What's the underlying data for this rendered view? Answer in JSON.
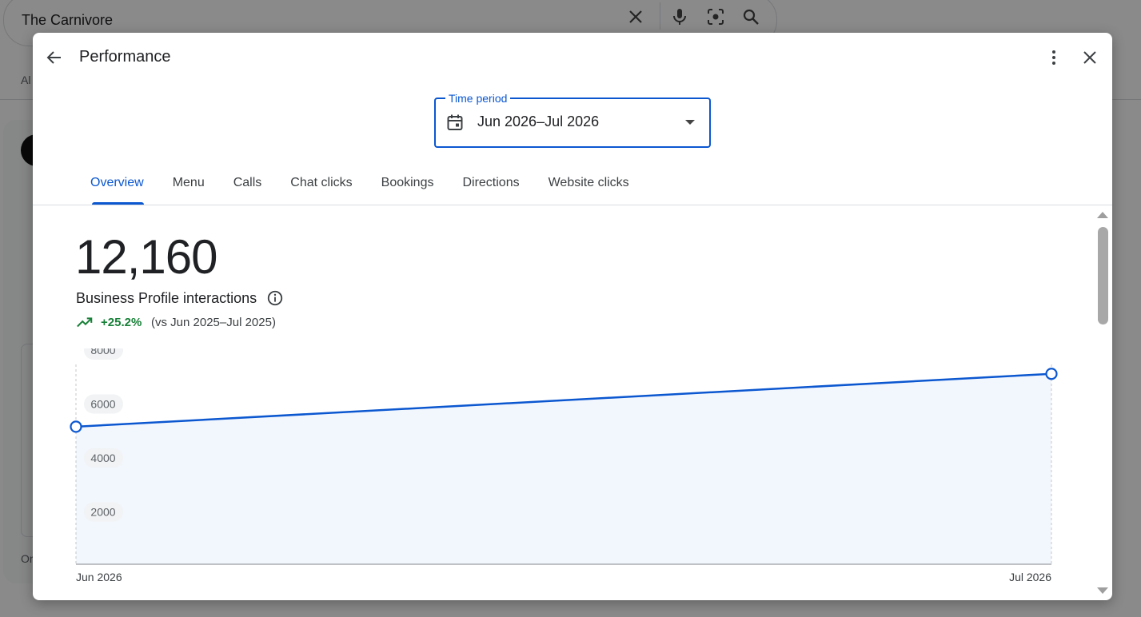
{
  "background": {
    "search_query": "The Carnivore",
    "tab_fragment": "Al",
    "footer_fragment": "Or"
  },
  "dialog": {
    "title": "Performance",
    "time_period": {
      "label": "Time period",
      "value": "Jun 2026–Jul 2026"
    },
    "tabs": [
      {
        "label": "Overview",
        "active": true
      },
      {
        "label": "Menu",
        "active": false
      },
      {
        "label": "Calls",
        "active": false
      },
      {
        "label": "Chat clicks",
        "active": false
      },
      {
        "label": "Bookings",
        "active": false
      },
      {
        "label": "Directions",
        "active": false
      },
      {
        "label": "Website clicks",
        "active": false
      }
    ],
    "summary": {
      "total": "12,160",
      "label": "Business Profile interactions",
      "change": "+25.2%",
      "comparison": "(vs Jun 2025–Jul 2025)"
    }
  },
  "colors": {
    "accent": "#0b57d0",
    "positive": "#188038",
    "area_fill": "#f2f6fd"
  },
  "chart_data": {
    "type": "area",
    "x": [
      "Jun 2026",
      "Jul 2026"
    ],
    "series": [
      {
        "values": [
          5100,
          7060
        ]
      }
    ],
    "y_ticks": [
      2000,
      4000,
      6000,
      8000
    ],
    "ylim": [
      0,
      8000
    ]
  }
}
